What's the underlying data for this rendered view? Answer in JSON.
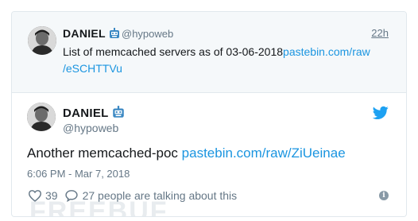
{
  "quoted_tweet": {
    "name": "DANIEL",
    "handle": "@hypoweb",
    "timestamp": "22h",
    "text": "List of memcached servers as of 03-06-2018",
    "link_part1": "pastebin.com/raw",
    "link_part2": "/eSCHTTVu"
  },
  "main_tweet": {
    "name": "DANIEL",
    "handle": "@hypoweb",
    "text": "Another memcached-poc",
    "link": "pastebin.com/raw/ZiUeinae",
    "date": "6:06 PM - Mar 7, 2018",
    "likes": "39",
    "talking": "27 people are talking about this"
  },
  "watermark": "FREEBUF",
  "colors": {
    "link": "#1b95e0",
    "muted": "#657786",
    "border": "#e1e8ed",
    "quoted_bg": "#f5f8fa"
  },
  "icons": [
    "robot-icon",
    "twitter-bird-icon",
    "heart-icon",
    "comment-icon",
    "info-icon"
  ]
}
